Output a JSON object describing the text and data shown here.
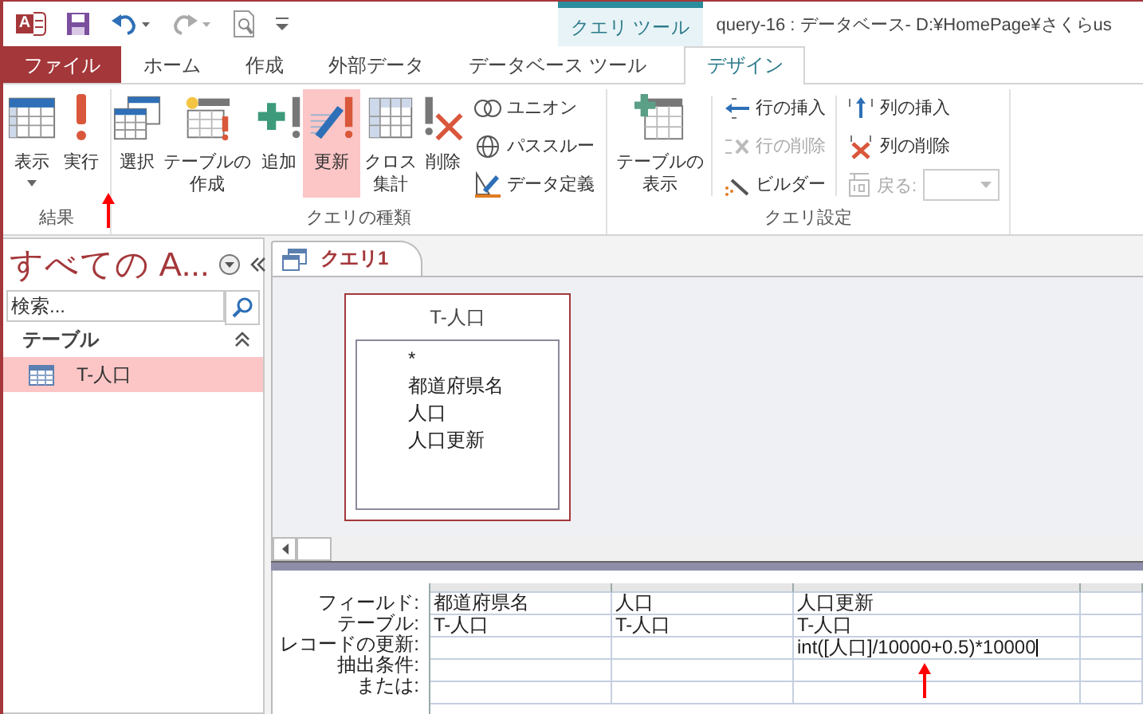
{
  "title_bar": {
    "logo_letter": "A",
    "context_tab": "クエリ ツール",
    "title": "query-16 : データベース- D:¥HomePage¥さくらus"
  },
  "ribbon_tabs": [
    {
      "label": "ファイル",
      "selected": false,
      "kind": "file"
    },
    {
      "label": "ホーム",
      "selected": false,
      "kind": "tab"
    },
    {
      "label": "作成",
      "selected": false,
      "kind": "tab"
    },
    {
      "label": "外部データ",
      "selected": false,
      "kind": "tab"
    },
    {
      "label": "データベース ツール",
      "selected": false,
      "kind": "tab"
    },
    {
      "label": "デザイン",
      "selected": true,
      "kind": "tab"
    }
  ],
  "ribbon_groups": [
    {
      "label": "結果",
      "buttons": [
        {
          "kind": "large",
          "label": "表示",
          "caret": true,
          "selected": false,
          "disabled": false
        },
        {
          "kind": "large",
          "label": "実行",
          "caret": false,
          "selected": false,
          "disabled": false
        }
      ]
    },
    {
      "label": "クエリの種類",
      "buttons": [
        {
          "kind": "large",
          "label": "選択",
          "caret": false,
          "selected": false,
          "disabled": false
        },
        {
          "kind": "large",
          "label": "テーブルの作成",
          "caret": false,
          "selected": false,
          "disabled": false
        },
        {
          "kind": "large",
          "label": "追加",
          "caret": false,
          "selected": false,
          "disabled": false
        },
        {
          "kind": "large",
          "label": "更新",
          "caret": false,
          "selected": true,
          "disabled": false
        },
        {
          "kind": "large",
          "label": "クロス集計",
          "caret": false,
          "selected": false,
          "disabled": false
        },
        {
          "kind": "large",
          "label": "削除",
          "caret": false,
          "selected": false,
          "disabled": false
        },
        {
          "kind": "small",
          "label": "ユニオン",
          "caret": false,
          "selected": false,
          "disabled": false
        },
        {
          "kind": "small",
          "label": "パススルー",
          "caret": false,
          "selected": false,
          "disabled": false
        },
        {
          "kind": "small",
          "label": "データ定義",
          "caret": false,
          "selected": false,
          "disabled": false
        }
      ]
    },
    {
      "label": "クエリ設定",
      "buttons": [
        {
          "kind": "large",
          "label": "テーブルの表示",
          "caret": false,
          "selected": false,
          "disabled": false
        },
        {
          "kind": "small",
          "label": "行の挿入",
          "caret": false,
          "selected": false,
          "disabled": false
        },
        {
          "kind": "small",
          "label": "行の削除",
          "caret": false,
          "selected": false,
          "disabled": true
        },
        {
          "kind": "small",
          "label": "ビルダー",
          "caret": false,
          "selected": false,
          "disabled": false
        },
        {
          "kind": "small",
          "label": "列の挿入",
          "caret": false,
          "selected": false,
          "disabled": false
        },
        {
          "kind": "small",
          "label": "列の削除",
          "caret": false,
          "selected": false,
          "disabled": false
        },
        {
          "kind": "combo",
          "label": "戻る:",
          "caret": true,
          "selected": false,
          "disabled": true
        }
      ]
    }
  ],
  "nav_pane": {
    "title": "すべての A...",
    "search": {
      "placeholder": "検索..."
    },
    "sections": [
      {
        "label": "テーブル",
        "expanded": true,
        "items": [
          {
            "label": "T-人口",
            "selected": true
          }
        ]
      }
    ]
  },
  "document_tabs": [
    {
      "label": "クエリ1",
      "selected": true
    }
  ],
  "field_list": {
    "title": "T-人口",
    "fields": [
      "*",
      "都道府県名",
      "人口",
      "人口更新"
    ]
  },
  "design_grid": {
    "row_labels": [
      "フィールド:",
      "テーブル:",
      "レコードの更新:",
      "抽出条件:",
      "または:"
    ],
    "columns": [
      {
        "field": "都道府県名",
        "table": "T-人口"
      },
      {
        "field": "人口",
        "table": "T-人口"
      },
      {
        "field": "人口更新",
        "table": "T-人口",
        "update": "int([人口]/10000+0.5)*10000"
      }
    ]
  }
}
